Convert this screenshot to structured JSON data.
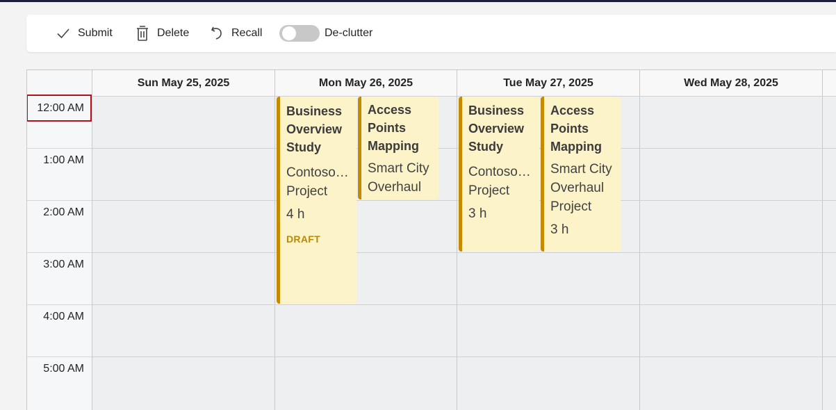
{
  "toolbar": {
    "submit_label": "Submit",
    "delete_label": "Delete",
    "recall_label": "Recall",
    "declutter_label": "De-clutter",
    "declutter_on": false
  },
  "calendar": {
    "days": [
      "Sun May 25, 2025",
      "Mon May 26, 2025",
      "Tue May 27, 2025",
      "Wed May 28, 2025"
    ],
    "times": [
      "12:00 AM",
      "1:00 AM",
      "2:00 AM",
      "3:00 AM",
      "4:00 AM",
      "5:00 AM"
    ],
    "selected_time": "12:00 AM"
  },
  "events": [
    {
      "day": "Mon May 26, 2025",
      "title": "Business Overview Study",
      "project": "Contoso Consulti...",
      "project_line2": "Project",
      "hours": "4 h",
      "status": "DRAFT"
    },
    {
      "day": "Mon May 26, 2025",
      "title": "Access Points Mapping",
      "project": "Smart City Overhaul",
      "project_line2": "",
      "hours": "",
      "status": ""
    },
    {
      "day": "Tue May 27, 2025",
      "title": "Business Overview Study",
      "project": "Contoso Consulti...",
      "project_line2": "Project",
      "hours": "3 h",
      "status": ""
    },
    {
      "day": "Tue May 27, 2025",
      "title": "Access Points Mapping",
      "project": "Smart City Overhaul",
      "project_line2": "Project",
      "hours": "3 h",
      "status": ""
    }
  ],
  "colors": {
    "event_bg": "#fdf3c8",
    "event_accent": "#c48a00",
    "selection_border": "#b3121b",
    "draft_text": "#b58a0a"
  }
}
